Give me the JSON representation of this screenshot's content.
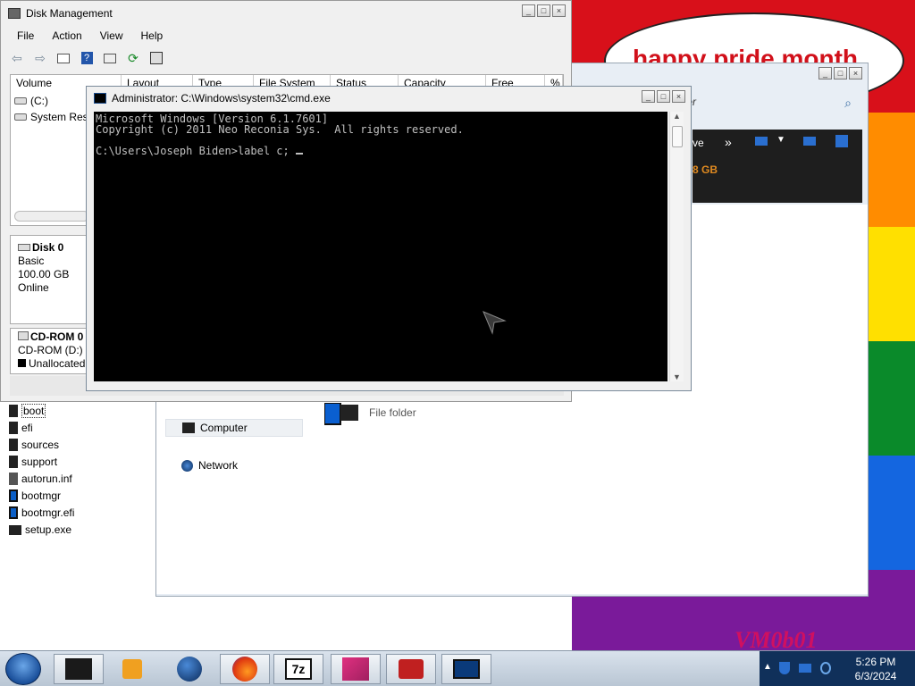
{
  "wallpaper": {
    "colors": [
      "#d8101a",
      "#ff8c00",
      "#ffe000",
      "#0a8a2a",
      "#1466e0",
      "#7a1a9a"
    ],
    "bubble_text": "happy pride month",
    "vm_text": "VM0b01"
  },
  "explorer": {
    "address_tail": "omputer",
    "toolbar_label": "ve",
    "size_text": "8 GB",
    "nav": [
      {
        "label": "Computer",
        "icon": "computer-icon"
      },
      {
        "label": "Network",
        "icon": "network-icon"
      }
    ],
    "file_folder_label": "File folder"
  },
  "diskmgmt": {
    "title": "Disk Management",
    "menu": [
      "File",
      "Action",
      "View",
      "Help"
    ],
    "columns": [
      "Volume",
      "Layout",
      "Type",
      "File System",
      "Status",
      "Capacity",
      "Free Spa...",
      "%"
    ],
    "volumes": [
      "(C:)",
      "System Rese"
    ],
    "disk0": {
      "name": "Disk 0",
      "type": "Basic",
      "size": "100.00 GB",
      "state": "Online"
    },
    "cdrom0": {
      "name": "CD-ROM 0",
      "drive": "CD-ROM (D:)",
      "unalloc": "Unallocated"
    }
  },
  "files": [
    {
      "name": "boot",
      "kind": "folder",
      "selected": true
    },
    {
      "name": "efi",
      "kind": "folder"
    },
    {
      "name": "sources",
      "kind": "folder"
    },
    {
      "name": "support",
      "kind": "folder"
    },
    {
      "name": "autorun.inf",
      "kind": "doc"
    },
    {
      "name": "bootmgr",
      "kind": "blue"
    },
    {
      "name": "bootmgr.efi",
      "kind": "blue"
    },
    {
      "name": "setup.exe",
      "kind": "exe"
    }
  ],
  "cmd": {
    "title": "Administrator: C:\\Windows\\system32\\cmd.exe",
    "lines": [
      "Microsoft Windows [Version 6.1.7601]",
      "Copyright (c) 2011 Neo Reconia Sys.  All rights reserved.",
      "",
      "C:\\Users\\Joseph Biden>label c; "
    ]
  },
  "taskbar": {
    "items": [
      "terminal-app",
      "media-player",
      "globe-app",
      "firefox",
      "7zip",
      "image-app",
      "toolbox-app",
      "monitor-app"
    ],
    "active_index": 4,
    "app_7z_label": "7z",
    "clock": {
      "time": "5:26 PM",
      "date": "6/3/2024"
    }
  }
}
